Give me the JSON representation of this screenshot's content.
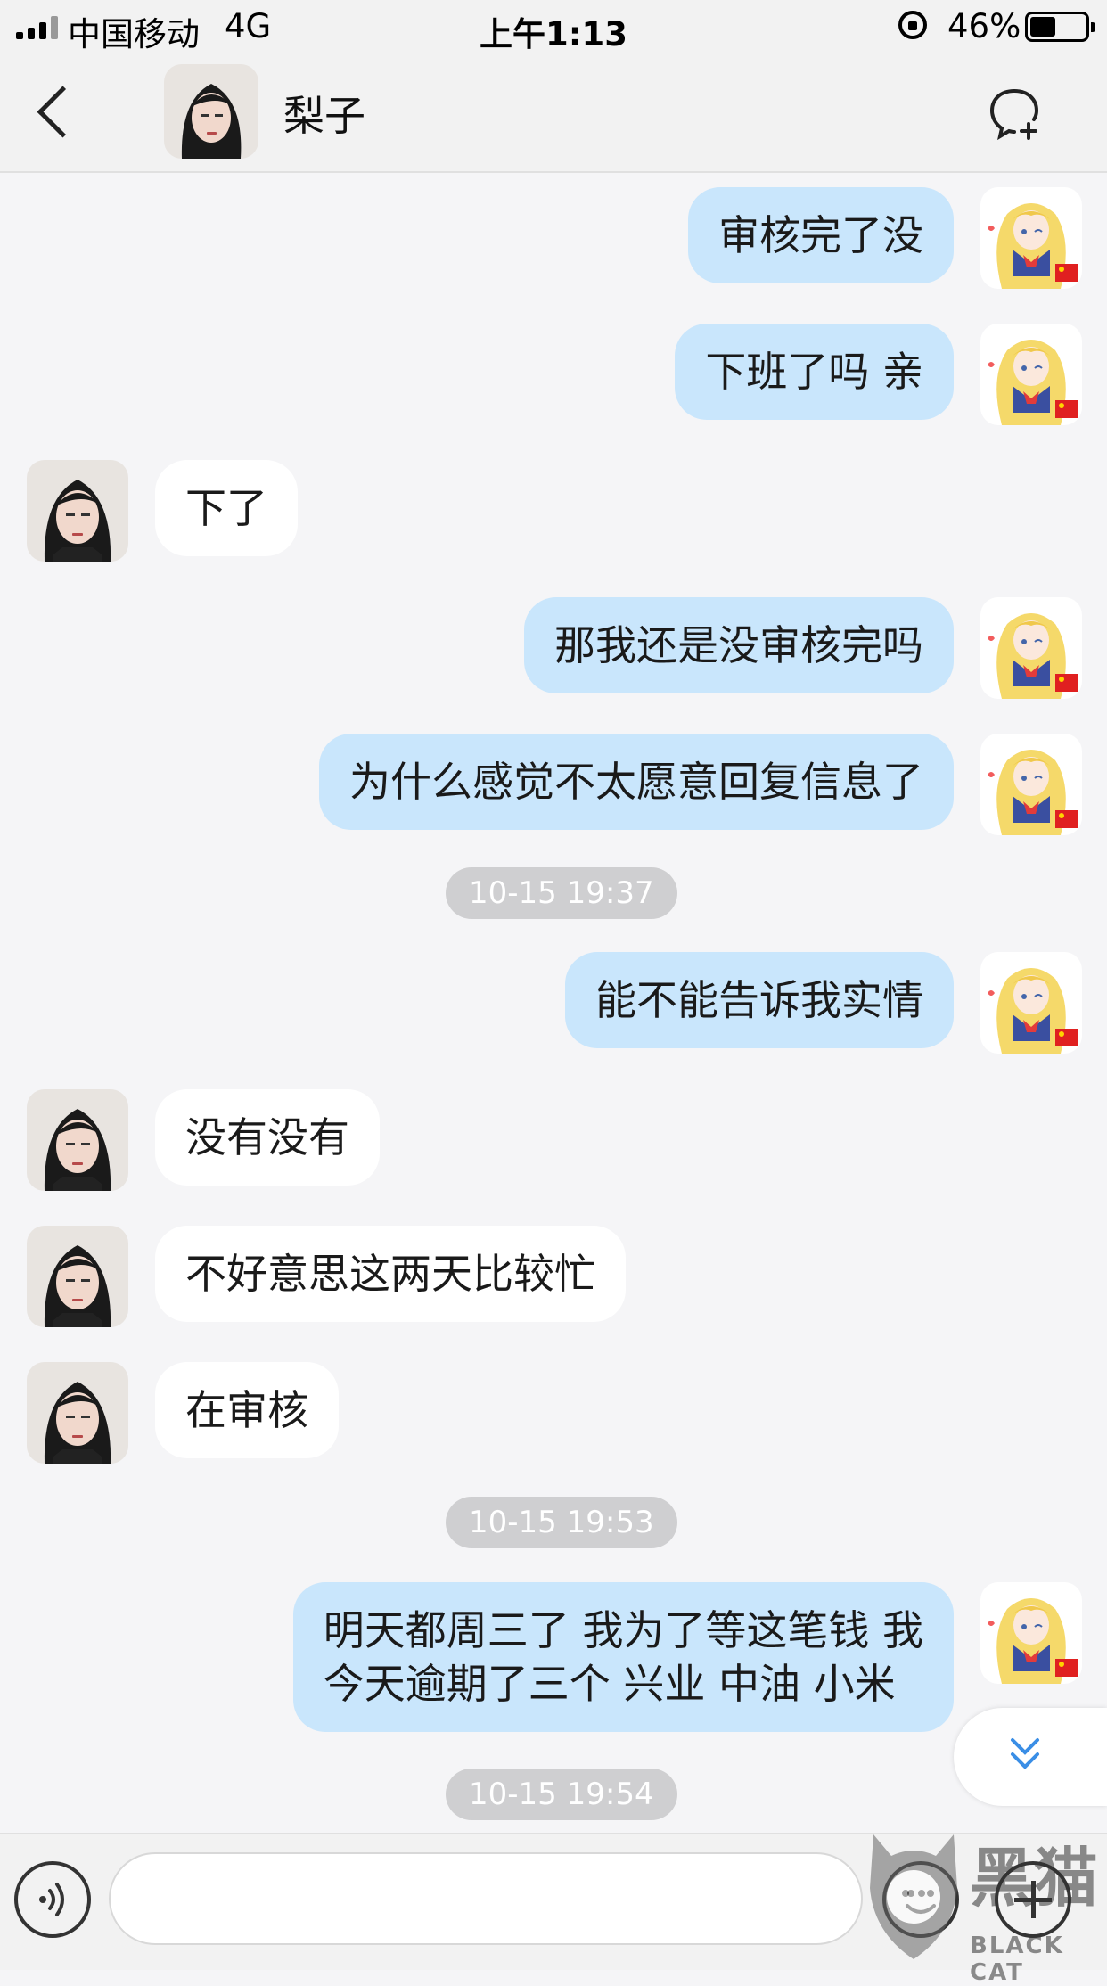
{
  "status_bar": {
    "carrier": "中国移动",
    "network": "4G",
    "time": "上午1:13",
    "battery_percent": "46%",
    "battery_level": 0.46
  },
  "header": {
    "contact_name": "梨子"
  },
  "messages": [
    {
      "id": "m1",
      "side": "sent",
      "text": "审核完了没"
    },
    {
      "id": "m2",
      "side": "sent",
      "text": "下班了吗 亲"
    },
    {
      "id": "m3",
      "side": "recv",
      "text": "下了"
    },
    {
      "id": "m4",
      "side": "sent",
      "text": "那我还是没审核完吗"
    },
    {
      "id": "m5",
      "side": "sent",
      "text": "为什么感觉不太愿意回复信息了"
    },
    {
      "id": "t1",
      "type": "time",
      "text": "10-15 19:37"
    },
    {
      "id": "m6",
      "side": "sent",
      "text": "能不能告诉我实情"
    },
    {
      "id": "m7",
      "side": "recv",
      "text": "没有没有"
    },
    {
      "id": "m8",
      "side": "recv",
      "text": "不好意思这两天比较忙"
    },
    {
      "id": "m9",
      "side": "recv",
      "text": "在审核"
    },
    {
      "id": "t2",
      "type": "time",
      "text": "10-15 19:53"
    },
    {
      "id": "m10",
      "side": "sent",
      "text": "明天都周三了 我为了等这笔钱 我\n今天逾期了三个 兴业 中油 小米"
    },
    {
      "id": "t3",
      "type": "time",
      "text": "10-15 19:54"
    }
  ],
  "input": {
    "placeholder": ""
  },
  "watermark": {
    "label": "黑猫",
    "sub": "BLACK CAT"
  },
  "colors": {
    "sent_bubble": "#c9e6fc",
    "recv_bubble": "#ffffff",
    "background": "#f5f5f7",
    "scroll_arrow": "#3a8ee6"
  }
}
